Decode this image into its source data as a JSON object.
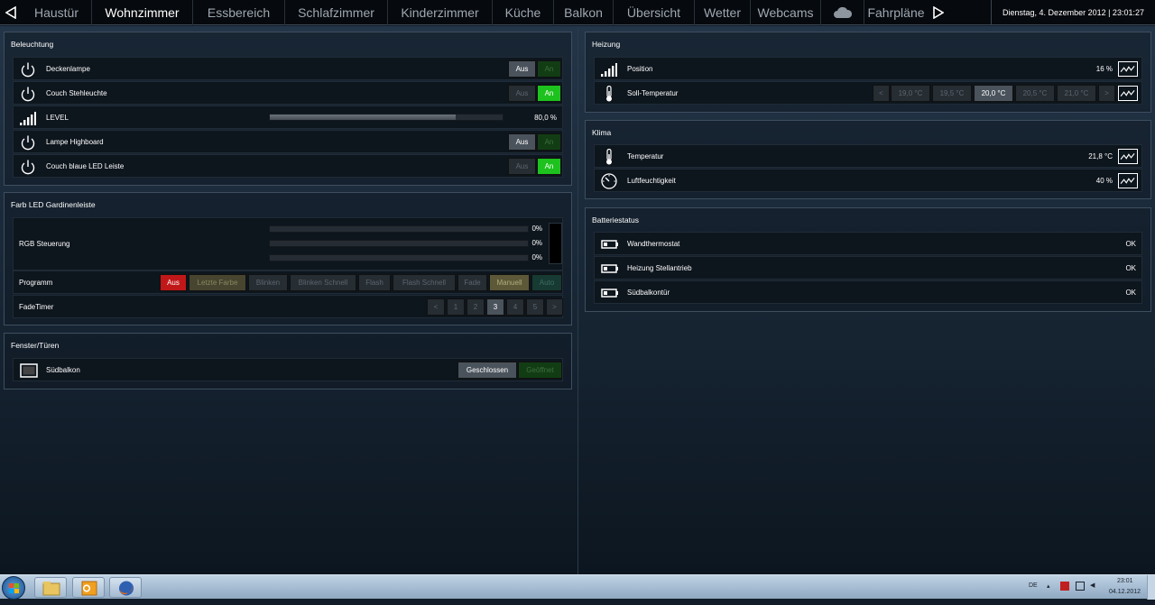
{
  "nav": {
    "tabs": [
      {
        "label": "Haustür",
        "width": 78
      },
      {
        "label": "Wohnzimmer",
        "width": 112
      },
      {
        "label": "Essbereich",
        "width": 102
      },
      {
        "label": "Schlafzimmer",
        "width": 114
      },
      {
        "label": "Kinderzimmer",
        "width": 116
      },
      {
        "label": "Küche",
        "width": 68
      },
      {
        "label": "Balkon",
        "width": 66
      },
      {
        "label": "Übersicht",
        "width": 90
      },
      {
        "label": "Wetter",
        "width": 62
      },
      {
        "label": "Webcams",
        "width": 78
      }
    ],
    "last_tab": "Fahrpläne",
    "clock": "Dienstag, 4. Dezember 2012 | 23:01:27"
  },
  "beleuchtung": {
    "title": "Beleuchtung",
    "rows": [
      "Deckenlampe",
      "Couch Stehleuchte",
      "LEVEL",
      "Lampe Highboard",
      "Couch blaue LED Leiste"
    ],
    "btn_off": "Aus",
    "btn_on": "An",
    "level_value": "80,0 %",
    "level_fraction": 0.8
  },
  "farb": {
    "title": "Farb LED Gardinenleiste",
    "rgb_label": "RGB Steuerung",
    "rgb_values": [
      "0%",
      "0%",
      "0%"
    ],
    "program_label": "Programm",
    "program_buttons": [
      "Aus",
      "Letzte Farbe",
      "Blinken",
      "Blinken Schnell",
      "Flash",
      "Flash Schnell",
      "Fade",
      "Manuell",
      "Auto"
    ],
    "fade_label": "FadeTimer",
    "fade_buttons": [
      "<",
      "1",
      "2",
      "3",
      "4",
      "5",
      ">"
    ]
  },
  "fenster": {
    "title": "Fenster/Türen",
    "row": "Südbalkon",
    "btn_closed": "Geschlossen",
    "btn_open": "Geöffnet"
  },
  "heizung": {
    "title": "Heizung",
    "position_label": "Position",
    "position_value": "16 %",
    "soll_label": "Soll-Temperatur",
    "temps": [
      "<",
      "19,0 °C",
      "19,5 °C",
      "20,0 °C",
      "20,5 °C",
      "21,0 °C",
      ">"
    ]
  },
  "klima": {
    "title": "Klima",
    "temp_label": "Temperatur",
    "temp_value": "21,8 °C",
    "hum_label": "Luftfeuchtigkeit",
    "hum_value": "40 %"
  },
  "batterie": {
    "title": "Batteriestatus",
    "rows": [
      {
        "label": "Wandthermostat",
        "status": "OK"
      },
      {
        "label": "Heizung Stellantrieb",
        "status": "OK"
      },
      {
        "label": "Südbalkontür",
        "status": "OK"
      }
    ]
  },
  "taskbar": {
    "lang": "DE",
    "time": "23:01",
    "date": "04.12.2012"
  }
}
